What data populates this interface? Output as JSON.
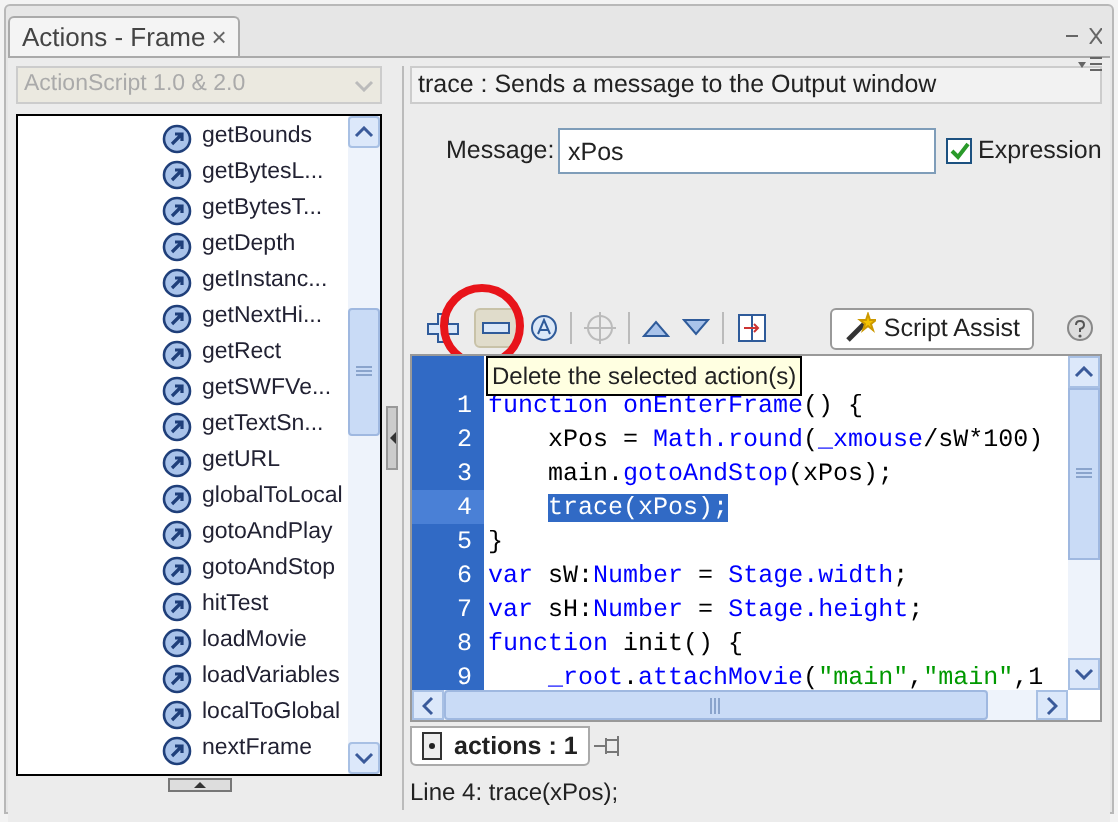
{
  "window": {
    "tab_title": "Actions - Frame",
    "close": "×"
  },
  "sidebar": {
    "language": "ActionScript 1.0 & 2.0",
    "items": [
      {
        "label": "getBounds"
      },
      {
        "label": "getBytesL..."
      },
      {
        "label": "getBytesT..."
      },
      {
        "label": "getDepth"
      },
      {
        "label": "getInstanc..."
      },
      {
        "label": "getNextHi..."
      },
      {
        "label": "getRect"
      },
      {
        "label": "getSWFVe..."
      },
      {
        "label": "getTextSn..."
      },
      {
        "label": "getURL"
      },
      {
        "label": "globalToLocal"
      },
      {
        "label": "gotoAndPlay"
      },
      {
        "label": "gotoAndStop"
      },
      {
        "label": "hitTest"
      },
      {
        "label": "loadMovie"
      },
      {
        "label": "loadVariables"
      },
      {
        "label": "localToGlobal"
      },
      {
        "label": "nextFrame"
      }
    ]
  },
  "description": "trace : Sends a message to the Output window",
  "message": {
    "label": "Message:",
    "value": "xPos"
  },
  "expression": {
    "label": "Expression",
    "checked": true
  },
  "toolbar": {
    "script_assist": "Script Assist",
    "tooltip": "Delete the selected action(s)"
  },
  "code_lines": [
    {
      "number": "1",
      "selected": false,
      "indented": false,
      "tokens": [
        {
          "text": "function onEnterFrame",
          "kind": "keyword"
        },
        {
          "text": "() {",
          "kind": "plain"
        }
      ]
    },
    {
      "number": "2",
      "selected": false,
      "indented": true,
      "tokens": [
        {
          "text": "xPos = ",
          "kind": "plain"
        },
        {
          "text": "Math.round",
          "kind": "keyword"
        },
        {
          "text": "(",
          "kind": "plain"
        },
        {
          "text": "_xmouse",
          "kind": "keyword"
        },
        {
          "text": "/sW*100)",
          "kind": "plain"
        }
      ]
    },
    {
      "number": "3",
      "selected": false,
      "indented": true,
      "tokens": [
        {
          "text": "main.",
          "kind": "plain"
        },
        {
          "text": "gotoAndStop",
          "kind": "keyword"
        },
        {
          "text": "(xPos);",
          "kind": "plain"
        }
      ]
    },
    {
      "number": "4",
      "selected": true,
      "indented": true,
      "tokens": [
        {
          "text": "trace(xPos);",
          "kind": "plain"
        }
      ]
    },
    {
      "number": "5",
      "selected": false,
      "indented": false,
      "tokens": [
        {
          "text": "}",
          "kind": "plain"
        }
      ]
    },
    {
      "number": "6",
      "selected": false,
      "indented": false,
      "tokens": [
        {
          "text": "var",
          "kind": "keyword"
        },
        {
          "text": " sW:",
          "kind": "plain"
        },
        {
          "text": "Number",
          "kind": "keyword"
        },
        {
          "text": " = ",
          "kind": "plain"
        },
        {
          "text": "Stage.width",
          "kind": "keyword"
        },
        {
          "text": ";",
          "kind": "plain"
        }
      ]
    },
    {
      "number": "7",
      "selected": false,
      "indented": false,
      "tokens": [
        {
          "text": "var",
          "kind": "keyword"
        },
        {
          "text": " sH:",
          "kind": "plain"
        },
        {
          "text": "Number",
          "kind": "keyword"
        },
        {
          "text": " = ",
          "kind": "plain"
        },
        {
          "text": "Stage.height",
          "kind": "keyword"
        },
        {
          "text": ";",
          "kind": "plain"
        }
      ]
    },
    {
      "number": "8",
      "selected": false,
      "indented": false,
      "tokens": [
        {
          "text": "function",
          "kind": "keyword"
        },
        {
          "text": " init() {",
          "kind": "plain"
        }
      ]
    },
    {
      "number": "9",
      "selected": false,
      "indented": true,
      "tokens": [
        {
          "text": "_root",
          "kind": "keyword"
        },
        {
          "text": ".",
          "kind": "plain"
        },
        {
          "text": "attachMovie",
          "kind": "keyword"
        },
        {
          "text": "(",
          "kind": "plain"
        },
        {
          "text": "\"main\"",
          "kind": "string"
        },
        {
          "text": ",",
          "kind": "plain"
        },
        {
          "text": "\"main\"",
          "kind": "string"
        },
        {
          "text": ",1",
          "kind": "plain"
        }
      ]
    }
  ],
  "script_tab": "actions : 1",
  "status_bar": "Line 4: trace(xPos);"
}
